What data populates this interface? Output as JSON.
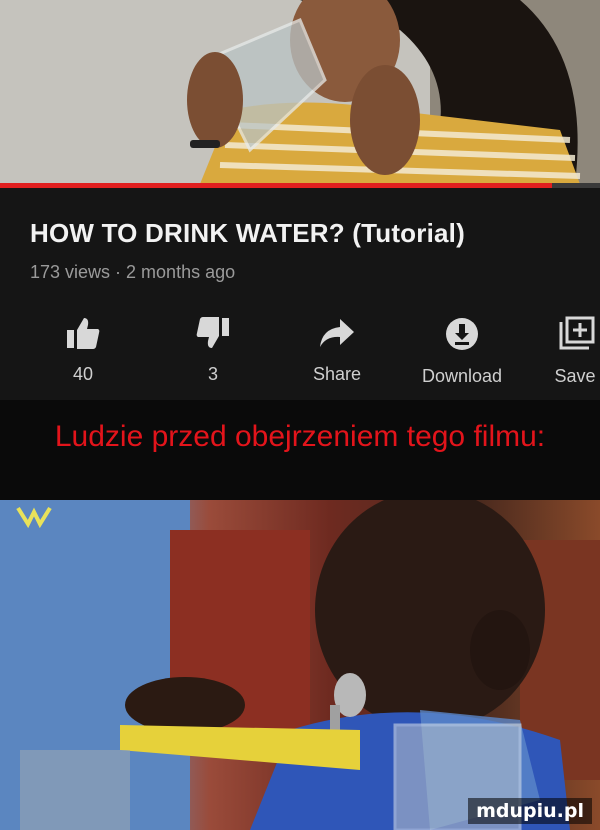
{
  "video": {
    "title": "HOW TO DRINK WATER? (Tutorial)",
    "meta": "173 views · 2 months ago",
    "progress_fraction": 0.92
  },
  "actions": [
    {
      "label": "40",
      "icon": "thumbs-up-icon"
    },
    {
      "label": "3",
      "icon": "thumbs-down-icon"
    },
    {
      "label": "Share",
      "icon": "share-arrow-icon"
    },
    {
      "label": "Download",
      "icon": "download-icon"
    },
    {
      "label": "Save",
      "icon": "save-playlist-icon"
    }
  ],
  "caption": "Ludzie przed obejrzeniem tego filmu:",
  "watermark": "mdupiu.pl",
  "colors": {
    "caption": "#e3141b",
    "progress": "#e01f1f"
  }
}
